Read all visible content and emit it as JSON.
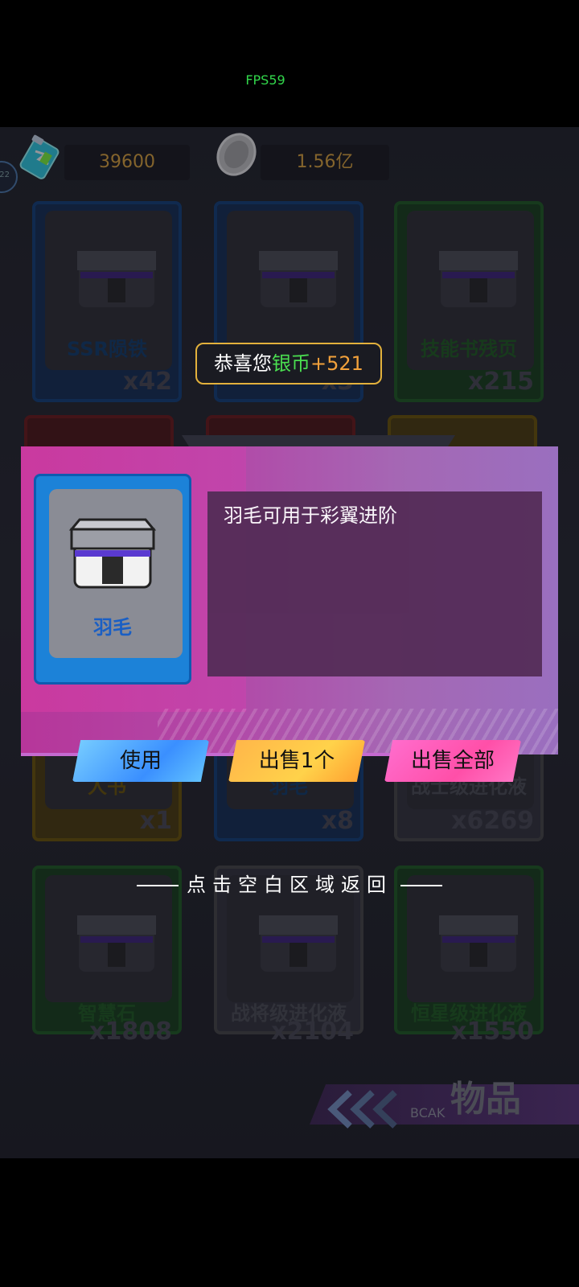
{
  "status": {
    "fps": "FPS59"
  },
  "currency": {
    "energy": {
      "icon": "energy-battery-icon",
      "value": "39600"
    },
    "silver": {
      "icon": "silver-coin-icon",
      "value": "1.56亿"
    },
    "level_badge": "22"
  },
  "grid": {
    "row1": [
      {
        "name": "SSR陨铁",
        "count": "x42",
        "frame": "blue"
      },
      {
        "name": "",
        "count": "x3",
        "frame": "blue"
      },
      {
        "name": "技能书残页",
        "count": "x215",
        "frame": "green"
      }
    ],
    "row3": [
      {
        "name": "人书",
        "count": "x1",
        "frame": "yellow"
      },
      {
        "name": "羽毛",
        "count": "x8",
        "frame": "blue"
      },
      {
        "name": "战士级进化液",
        "count": "x6269",
        "frame": "grey"
      }
    ],
    "row4": [
      {
        "name": "智慧石",
        "count": "x1808",
        "frame": "green"
      },
      {
        "name": "战将级进化液",
        "count": "x2104",
        "frame": "grey"
      },
      {
        "name": "恒星级进化液",
        "count": "x1550",
        "frame": "green"
      }
    ]
  },
  "toast": {
    "prefix": "恭喜您",
    "currency": "银币",
    "amount": "+521"
  },
  "detail": {
    "item_name": "羽毛",
    "description": "羽毛可用于彩翼进阶",
    "buttons": {
      "use": "使用",
      "sell_one": "出售1个",
      "sell_all": "出售全部"
    }
  },
  "hint": "点击空白区域返回",
  "footer": {
    "title": "物品",
    "back": "BCAK"
  },
  "colors": {
    "accent_gold": "#e0a63a",
    "toast_green": "#4ade50",
    "panel_pink": "#b6369a"
  }
}
